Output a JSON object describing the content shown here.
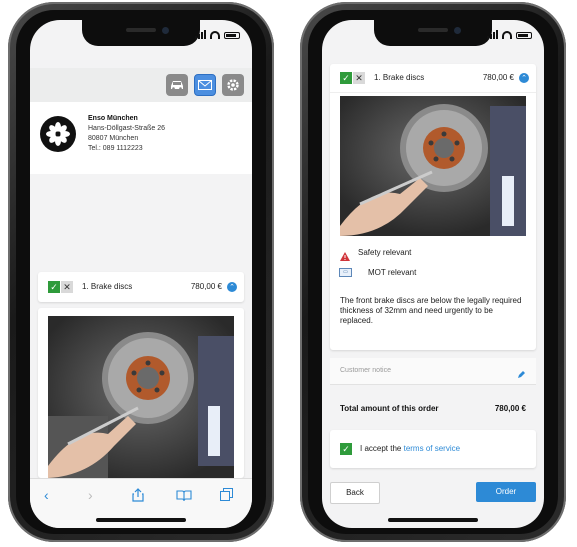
{
  "left_phone": {
    "toolbar": {
      "car_icon": "car-icon",
      "mail_icon": "mail-icon",
      "settings_icon": "gear-icon"
    },
    "company": {
      "name": "Enso München",
      "street": "Hans-Döllgast-Straße 26",
      "city": "80807 München",
      "phone": "Tel.: 089 1112223"
    },
    "item": {
      "label": "1. Brake discs",
      "price": "780,00 €"
    },
    "browser_bar": [
      "chevron-left-icon",
      "chevron-right-icon",
      "share-icon",
      "book-icon",
      "tabs-icon"
    ]
  },
  "right_phone": {
    "item": {
      "label": "1. Brake discs",
      "price": "780,00 €"
    },
    "flags": {
      "safety": "Safety relevant",
      "mot": "MOT relevant"
    },
    "description": "The front brake discs are below the legally required thickness of 32mm and need urgently to be replaced.",
    "notice_placeholder": "Customer notice",
    "total_label": "Total amount of this order",
    "total_value": "780,00 €",
    "accept_prefix": "I accept the ",
    "accept_link": "terms of service",
    "back_label": "Back",
    "order_label": "Order"
  },
  "colors": {
    "accent": "#2d8ad6",
    "check_green": "#2f9b3b",
    "warning_red": "#d0343a"
  }
}
